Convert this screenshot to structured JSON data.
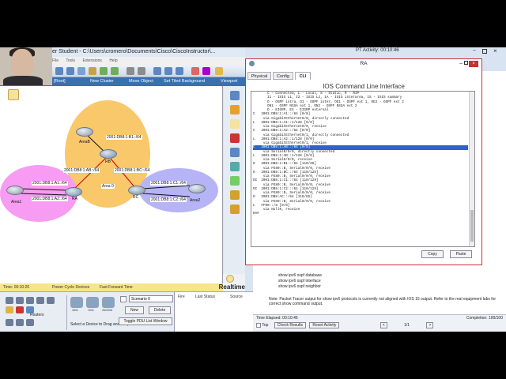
{
  "main_window": {
    "title": "er Student - C:\\Users\\cromero\\Documents\\Cisco\\CiscoInstructor\\...",
    "menu": [
      "File",
      "Tools",
      "Extensions",
      "Help"
    ],
    "nav": {
      "root": "[Root]",
      "new_cluster": "New Cluster",
      "move_object": "Move Object",
      "set_tiled_background": "Set Tiled Background",
      "viewport": "Viewport"
    }
  },
  "topology": {
    "labels": {
      "rb_fa": "2001:DB8:1:B1::/64",
      "ab": "2001:DB8:1:AB::/64",
      "bc": "2001:DB8:1:BC::/64",
      "ra_a1": "2001:DB8:1:A1::/64",
      "ra_a2": "2001:DB8:1:A2::/64",
      "rc_c1": "2001:DB8:1:C1::/64",
      "rc_c2": "2001:DB8:1:C2::/64",
      "area0": "Area 0",
      "rb": "RB",
      "ra": "RA",
      "rc": "RC",
      "areab": "AreaB",
      "area1": "Area1",
      "area2": "Area2"
    }
  },
  "status_bar": {
    "time": "Time: 00:10:26",
    "cycle": "Power Cycle Devices",
    "fast_forward": "Fast Forward Time",
    "realtime": "Realtime"
  },
  "bottom_panel": {
    "routers": "Routers",
    "models": [
      "1841",
      "1941",
      "2620XM"
    ],
    "drag_hint": "Select a Device to Drag and Drop to th",
    "scenario": "Scenario 0",
    "new": "New",
    "delete": "Delete",
    "toggle": "Toggle PDU List Window",
    "columns": [
      "Fire",
      "Last Status",
      "Source"
    ]
  },
  "router_window": {
    "title": "RA",
    "tabs": [
      "Physical",
      "Config",
      "CLI"
    ],
    "heading": "IOS Command Line Interface",
    "lines": [
      "       C - Connected, L - Local, S - Static, R - RIP",
      "       I1 - ISIS L1, I2 - ISIS L2, IA - ISIS interarea, IS - ISIS summary",
      "       O - OSPF intra, OI - OSPF inter, OE1 - OSPF ext 1, OE2 - OSPF ext 2",
      "       ON1 - OSPF NSSA ext 1, ON2 - OSPF NSSA ext 2",
      "       D - EIGRP, EX - EIGRP external",
      "C   2001:DB8:1:A1::/64 [0/0]",
      "     via GigabitEthernet0/0, directly connected",
      "L   2001:DB8:1:A1::1/128 [0/0]",
      "     via GigabitEthernet0/0, receive",
      "C   2001:DB8:1:A2::/64 [0/0]",
      "     via GigabitEthernet0/1, directly connected",
      "L   2001:DB8:1:A2::1/128 [0/0]",
      "     via GigabitEthernet0/1, receive",
      "C   2001:DB8:1:AB::/64 [0/0]",
      "     via Serial0/0/0, directly connected",
      "L   2001:DB8:1:AB::1/128 [0/0]",
      "     via Serial0/0/0, receive",
      "O   2001:DB8:1:B1::/64 [110/65]",
      "     via FE80::B, Serial0/0/0, receive",
      "O   2001:DB8:1:BC::/64 [110/128]",
      "     via FE80::B, Serial0/0/0, receive",
      "OI  2001:DB8:1:C1::/64 [110/129]",
      "     via FE80::B, Serial0/0/0, receive",
      "OI  2001:DB8:1:C2::/64 [110/129]",
      "     via FE80::B, Serial0/0/0, receive",
      "O   2001:DB8:AC::/64 [110/65]",
      "     via FE80::B, Serial0/0/0, receive",
      "L   FF00::/8 [0/0]",
      "     via Null0, receive",
      "RA#"
    ],
    "highlight_index": 13,
    "copy": "Copy",
    "paste": "Paste"
  },
  "activity": {
    "title": "PT Activity: 00:10:46",
    "commands": [
      "show ipv6 ospf database",
      "show ipv6 ospf interface",
      "show ipv6 ospf neighbor"
    ],
    "note": "Note: Packet Tracer output for show ipv6 protocols is currently not aligned with IOS 15 output. Refer to the real equipment labs for correct show command output.",
    "time_elapsed": "Time Elapsed: 00:10:46",
    "completion": "Completion: 100/100",
    "top": "Top",
    "check_results": "Check Results",
    "reset_activity": "Reset Activity",
    "page": "1/1"
  },
  "colors": {
    "area0": "#f8c86a",
    "area1": "#f79cf2",
    "area2": "#b6b4f7",
    "nav": "#3a6fb0",
    "highlight": "#2f63c9"
  }
}
